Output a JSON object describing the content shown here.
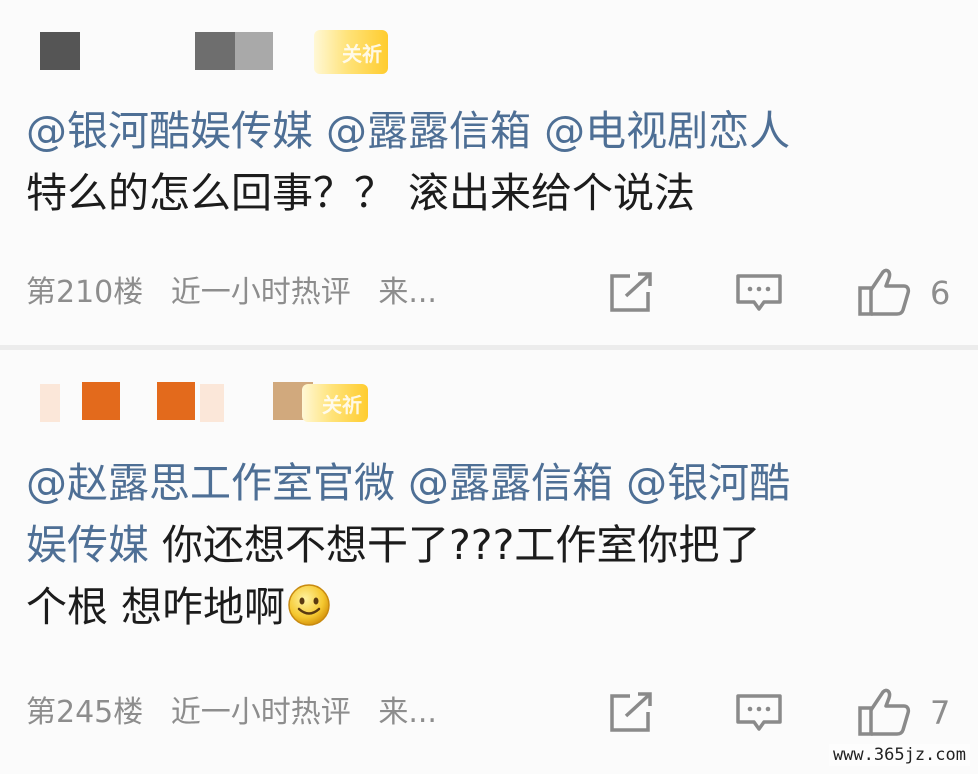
{
  "comments": [
    {
      "mentions": [
        "@银河酷娱传媒",
        "@露露信箱",
        "@电视剧恋人"
      ],
      "line1_text": "",
      "line2": "特么的怎么回事？？ 滚出来给个说法",
      "floor": "第210楼",
      "tag": "近一小时热评",
      "source": "来...",
      "like_count": "6",
      "badge_label": "关祈"
    },
    {
      "mentions": [
        "@赵露思工作室官微",
        "@露露信箱",
        "@银河酷"
      ],
      "line2_mention": "娱传媒",
      "line2_text": "你还想不想干了???工作室你把了",
      "line3": "个根 想咋地啊",
      "floor": "第245楼",
      "tag": "近一小时热评",
      "source": "来...",
      "like_count": "7",
      "badge_label": "关祈"
    }
  ],
  "icons": {
    "share": "share-icon",
    "comment": "comment-icon",
    "like": "thumbs-up-icon",
    "emoji": "smiley-emoji"
  },
  "watermark": "www.365jz.com",
  "colors": {
    "mention": "#4e6f95",
    "meta": "#8d8d8d",
    "badge": "#ffcc2e"
  }
}
